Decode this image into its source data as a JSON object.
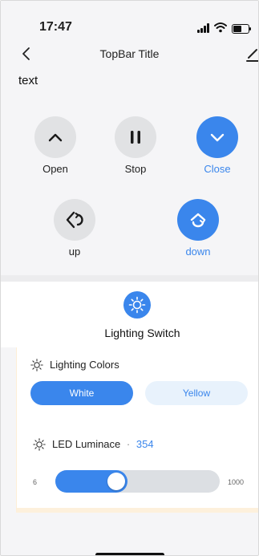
{
  "status_bar": {
    "time": "17:47"
  },
  "top_bar": {
    "title": "TopBar Title"
  },
  "text_label": "text",
  "controls_row1": [
    {
      "label": "Open",
      "icon": "chevron-up-icon",
      "active": false
    },
    {
      "label": "Stop",
      "icon": "pause-icon",
      "active": false
    },
    {
      "label": "Close",
      "icon": "chevron-down-icon",
      "active": true
    }
  ],
  "controls_row2": [
    {
      "label": "up",
      "icon": "rotate-left-icon",
      "active": false
    },
    {
      "label": "down",
      "icon": "rotate-right-icon",
      "active": true
    }
  ],
  "lighting": {
    "switch_label": "Lighting Switch",
    "colors_label": "Lighting Colors",
    "color_options": [
      "White",
      "Yellow"
    ],
    "selected_color": "White",
    "luminance_label": "LED Luminace",
    "luminance_separator": "·",
    "luminance_value": "354",
    "slider_min": "6",
    "slider_max": "1000"
  },
  "colors": {
    "accent": "#3a86ec",
    "inactive_circle": "#e1e2e4",
    "pill_inactive": "#e8f2fc"
  }
}
